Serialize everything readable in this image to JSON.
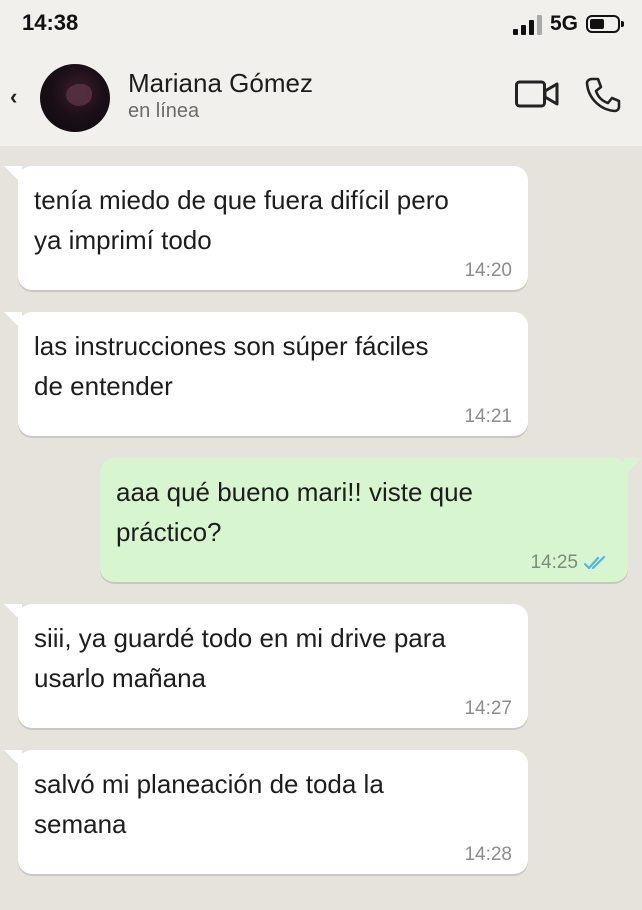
{
  "status_bar": {
    "time": "14:38",
    "network": "5G",
    "signal_bars": 4,
    "battery_level": 0.55
  },
  "header": {
    "back_label": "‹",
    "contact_name": "Mariana Gómez",
    "contact_status": "en línea",
    "actions": [
      "video-camera-icon",
      "phone-icon"
    ]
  },
  "messages": [
    {
      "direction": "in",
      "text": "tenía miedo de que fuera difícil pero\nya imprimí todo",
      "time": "14:20"
    },
    {
      "direction": "in",
      "text": "las instrucciones son súper fáciles\nde entender",
      "time": "14:21"
    },
    {
      "direction": "out",
      "text": "aaa qué bueno mari!! viste que\npráctico?",
      "time": "14:25",
      "receipt": "double-check-icon",
      "receipt_color": "#4fb6ec"
    },
    {
      "direction": "in",
      "text": "siii, ya guardé todo en mi drive para\nusarlo mañana",
      "time": "14:27"
    },
    {
      "direction": "in",
      "text": "salvó mi planeación de toda la\nsemana",
      "time": "14:28"
    }
  ],
  "colors": {
    "chat_background": "#e5e3db",
    "incoming_bubble": "#ffffff",
    "outgoing_bubble": "#d7f6d0",
    "header_background": "#f1f0ec"
  }
}
